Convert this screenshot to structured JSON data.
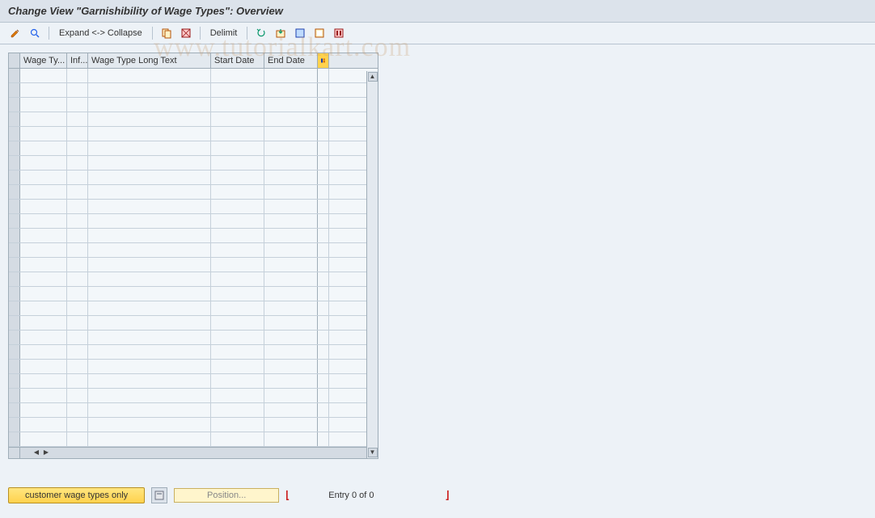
{
  "header": {
    "title": "Change View \"Garnishibility of Wage Types\": Overview"
  },
  "toolbar": {
    "expand_collapse": "Expand <-> Collapse",
    "delimit": "Delimit"
  },
  "table": {
    "columns": {
      "wage_type": "Wage Ty...",
      "inf": "Inf...",
      "long_text": "Wage Type Long Text",
      "start_date": "Start Date",
      "end_date": "End Date"
    },
    "row_count": 26
  },
  "footer": {
    "customer_btn": "customer wage types only",
    "position_label": "Position...",
    "entry_text": "Entry 0 of 0"
  },
  "watermark": "www.tutorialkart.com"
}
